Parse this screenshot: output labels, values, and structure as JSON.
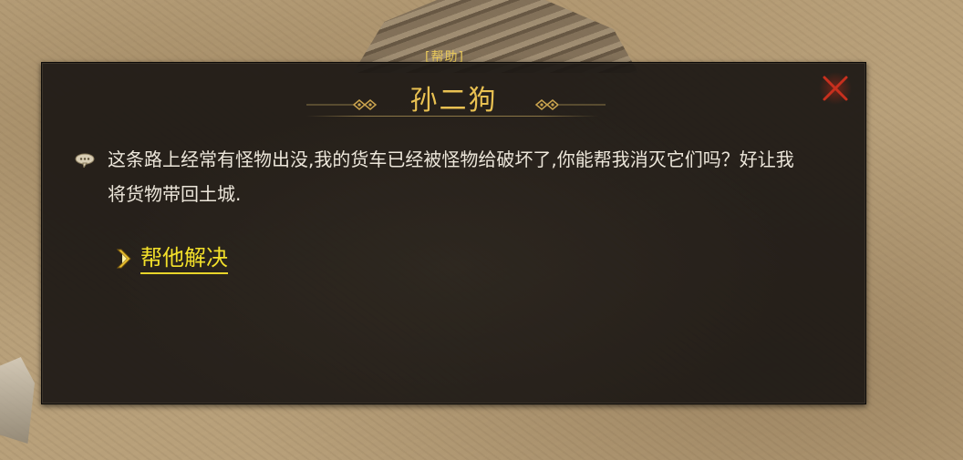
{
  "scene": {
    "cart_label": "[帮助]"
  },
  "dialog": {
    "title": "孙二狗",
    "message": "这条路上经常有怪物出没,我的货车已经被怪物给破坏了,你能帮我消灭它们吗？好让我将货物带回土城.",
    "options": [
      {
        "label": "帮他解决"
      }
    ],
    "close_icon": "close-x-icon",
    "speech_icon": "speech-bubble-icon",
    "colors": {
      "title": "#e9c152",
      "option": "#f3e02a",
      "text": "#ece6da",
      "close": "#c8301e"
    }
  }
}
